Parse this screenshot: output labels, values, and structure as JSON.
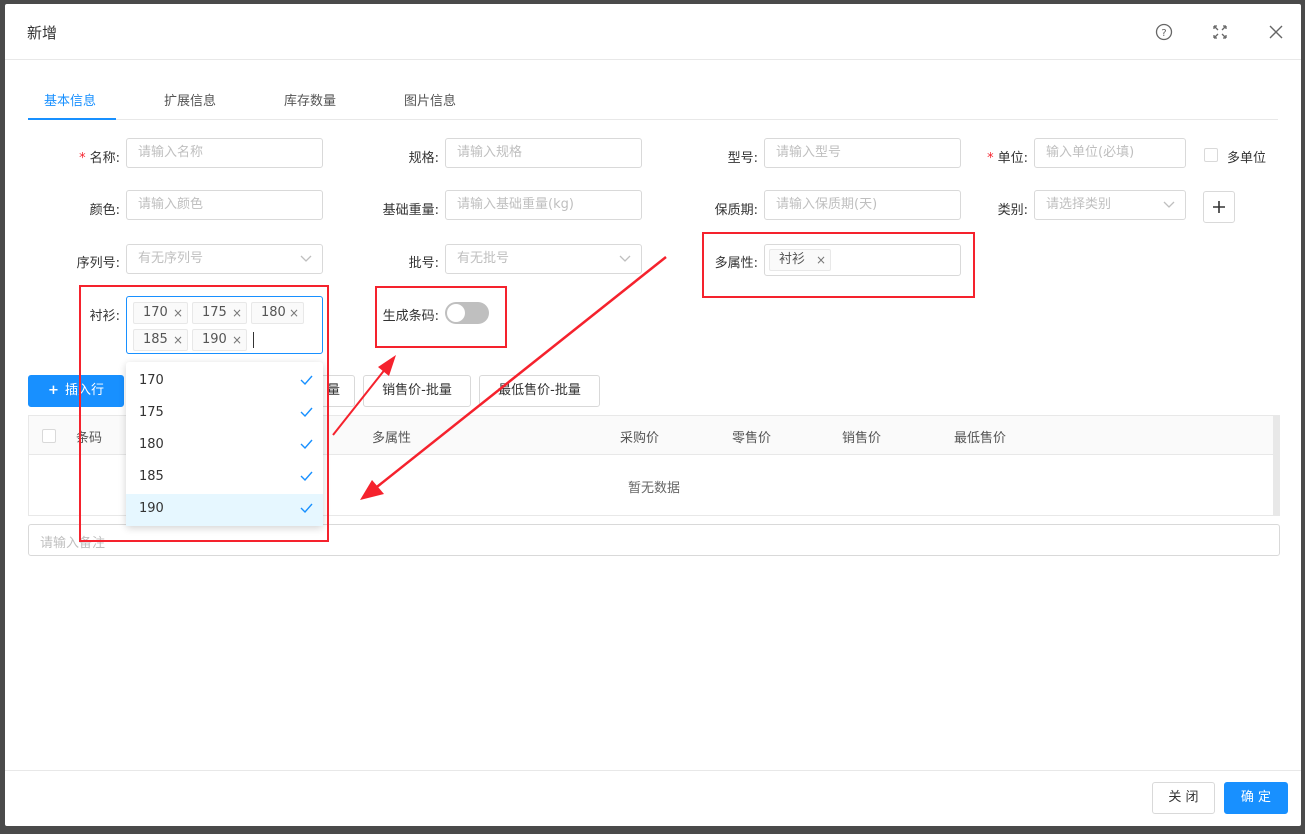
{
  "modal": {
    "title": "新增",
    "icons": [
      "help-icon",
      "fullscreen-icon",
      "close-icon"
    ]
  },
  "tabs": [
    {
      "label": "基本信息",
      "active": true
    },
    {
      "label": "扩展信息",
      "active": false
    },
    {
      "label": "库存数量",
      "active": false
    },
    {
      "label": "图片信息",
      "active": false
    }
  ],
  "form": {
    "name": {
      "label": "名称:",
      "placeholder": "请输入名称",
      "required": true
    },
    "spec": {
      "label": "规格:",
      "placeholder": "请输入规格"
    },
    "model": {
      "label": "型号:",
      "placeholder": "请输入型号"
    },
    "unit": {
      "label": "单位:",
      "placeholder": "输入单位(必填)",
      "required": true
    },
    "multi_unit": {
      "label": "多单位",
      "checked": false
    },
    "color": {
      "label": "颜色:",
      "placeholder": "请输入颜色"
    },
    "base_weight": {
      "label": "基础重量:",
      "placeholder": "请输入基础重量(kg)"
    },
    "shelf_life": {
      "label": "保质期:",
      "placeholder": "请输入保质期(天)"
    },
    "category": {
      "label": "类别:",
      "placeholder": "请选择类别"
    },
    "serial": {
      "label": "序列号:",
      "placeholder": "有无序列号"
    },
    "batch": {
      "label": "批号:",
      "placeholder": "有无批号"
    },
    "multi_attr": {
      "label": "多属性:",
      "tags": [
        "衬衫"
      ]
    },
    "shirt": {
      "label": "衬衫:",
      "tags": [
        "170",
        "175",
        "180",
        "185",
        "190"
      ]
    },
    "barcode": {
      "label": "生成条码:",
      "enabled": false
    }
  },
  "toolbar": {
    "insert_row": "插入行",
    "batch_partial": "量",
    "sale_price_batch": "销售价-批量",
    "min_price_batch": "最低售价-批量"
  },
  "table": {
    "columns": [
      "条码",
      "多属性",
      "采购价",
      "零售价",
      "销售价",
      "最低售价"
    ],
    "empty_text": "暂无数据"
  },
  "remark": {
    "placeholder": "请输入备注"
  },
  "dropdown": {
    "options": [
      {
        "label": "170",
        "selected": true
      },
      {
        "label": "175",
        "selected": true
      },
      {
        "label": "180",
        "selected": true
      },
      {
        "label": "185",
        "selected": true
      },
      {
        "label": "190",
        "selected": true
      }
    ]
  },
  "footer": {
    "close": "关 闭",
    "confirm": "确 定"
  },
  "colors": {
    "primary": "#1890ff",
    "annotation": "#f5222d"
  }
}
